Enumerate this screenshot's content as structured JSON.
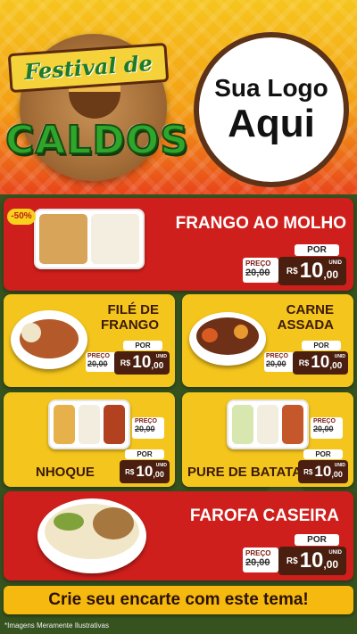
{
  "header": {
    "title_top": "Festival de",
    "title_main": "CALDOS",
    "logo_line1": "Sua Logo",
    "logo_line2": "Aqui"
  },
  "badge": "-50%",
  "currency": "R$",
  "labels": {
    "por": "POR",
    "preco": "PREÇO",
    "unid": "UNID"
  },
  "items": [
    {
      "name": "FRANGO AO MOLHO",
      "old_price": "20,00",
      "price_int": "10",
      "price_cents": ",00"
    },
    {
      "name_line1": "FILÉ DE",
      "name_line2": "FRANGO",
      "old_price": "20,00",
      "price_int": "10",
      "price_cents": ",00"
    },
    {
      "name_line1": "CARNE",
      "name_line2": "ASSADA",
      "old_price": "20,00",
      "price_int": "10",
      "price_cents": ",00"
    },
    {
      "name": "NHOQUE",
      "old_price": "20,00",
      "price_int": "10",
      "price_cents": ",00"
    },
    {
      "name": "PURE DE BATATA",
      "old_price": "20,00",
      "price_int": "10",
      "price_cents": ",00"
    },
    {
      "name": "FAROFA CASEIRA",
      "old_price": "20,00",
      "price_int": "10",
      "price_cents": ",00"
    }
  ],
  "cta": "Crie seu encarte com este tema!",
  "disclaimer": "*Imagens Meramente Ilustrativas",
  "colors": {
    "red": "#cf1f1c",
    "yellow": "#f4c51c",
    "dark_brown": "#4a1f10",
    "green": "#2fa62b"
  }
}
